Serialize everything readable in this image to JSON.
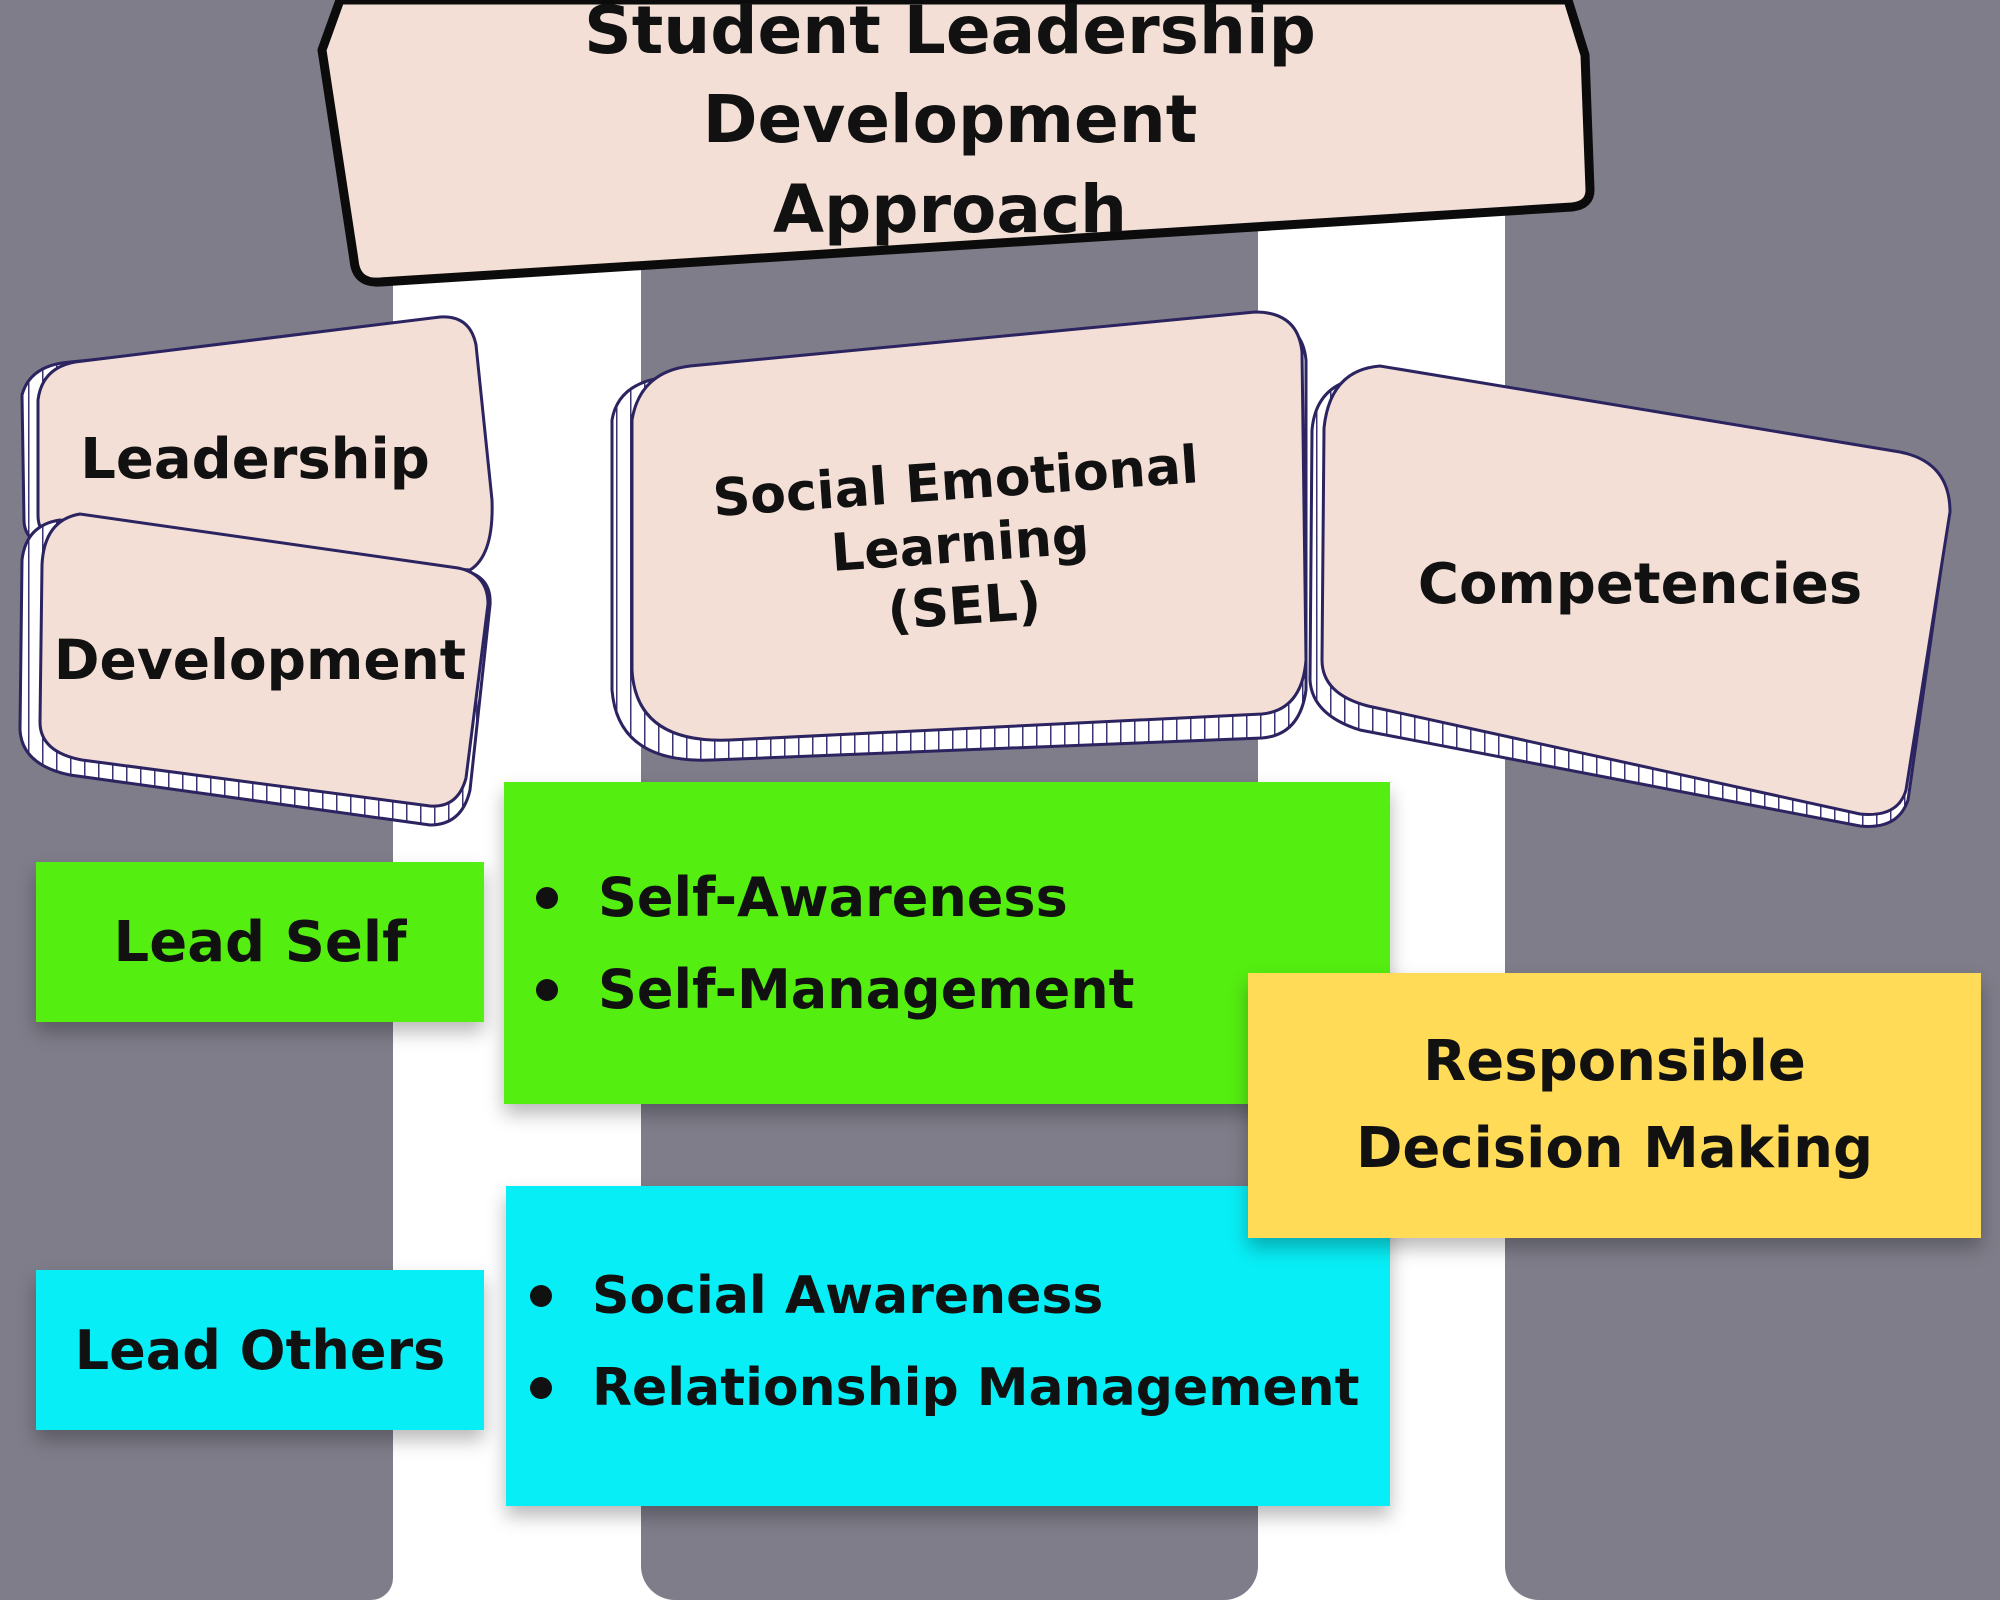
{
  "title": {
    "line1": "Student Leadership Development",
    "line2": "Approach"
  },
  "pillars": {
    "leadership": "Leadership",
    "development": "Development",
    "sel": {
      "line1": "Social Emotional",
      "line2": "Learning",
      "line3": "(SEL)"
    },
    "competencies": "Competencies"
  },
  "lead_self": {
    "label": "Lead Self",
    "items": [
      "Self-Awareness",
      "Self-Management"
    ]
  },
  "lead_others": {
    "label": "Lead Others",
    "items": [
      "Social Awareness",
      "Relationship Management"
    ]
  },
  "responsible": {
    "line1": "Responsible",
    "line2": "Decision Making"
  },
  "colors": {
    "background_stripes": "#7e7d89",
    "card_fill": "#f3dfd6",
    "card_outline": "#2b2460",
    "green": "#55ee11",
    "cyan": "#08eef6",
    "yellow": "#ffdb58"
  }
}
